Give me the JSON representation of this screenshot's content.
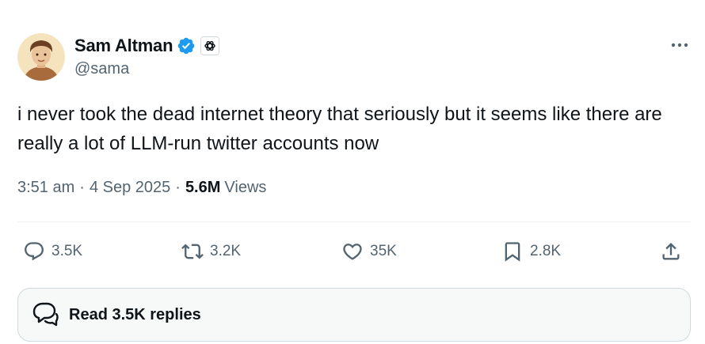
{
  "author": {
    "display_name": "Sam Altman",
    "handle": "@sama",
    "avatar_icon": "profile-avatar",
    "verified_icon": "verified-badge-icon",
    "affiliate_icon": "openai-logo-icon"
  },
  "tweet": {
    "text": "i never took the dead internet theory that seriously but it seems like there are really a lot of LLM-run twitter accounts now",
    "time": "3:51 am",
    "date": "4 Sep 2025",
    "views_count": "5.6M",
    "views_label": "Views"
  },
  "actions": {
    "replies": "3.5K",
    "reposts": "3.2K",
    "likes": "35K",
    "bookmarks": "2.8K"
  },
  "read_replies_label": "Read 3.5K replies",
  "colors": {
    "text_primary": "#0f1419",
    "text_secondary": "#536471",
    "verified_blue": "#1d9bf0",
    "border": "#cfd9de",
    "divider": "#eff3f4"
  }
}
